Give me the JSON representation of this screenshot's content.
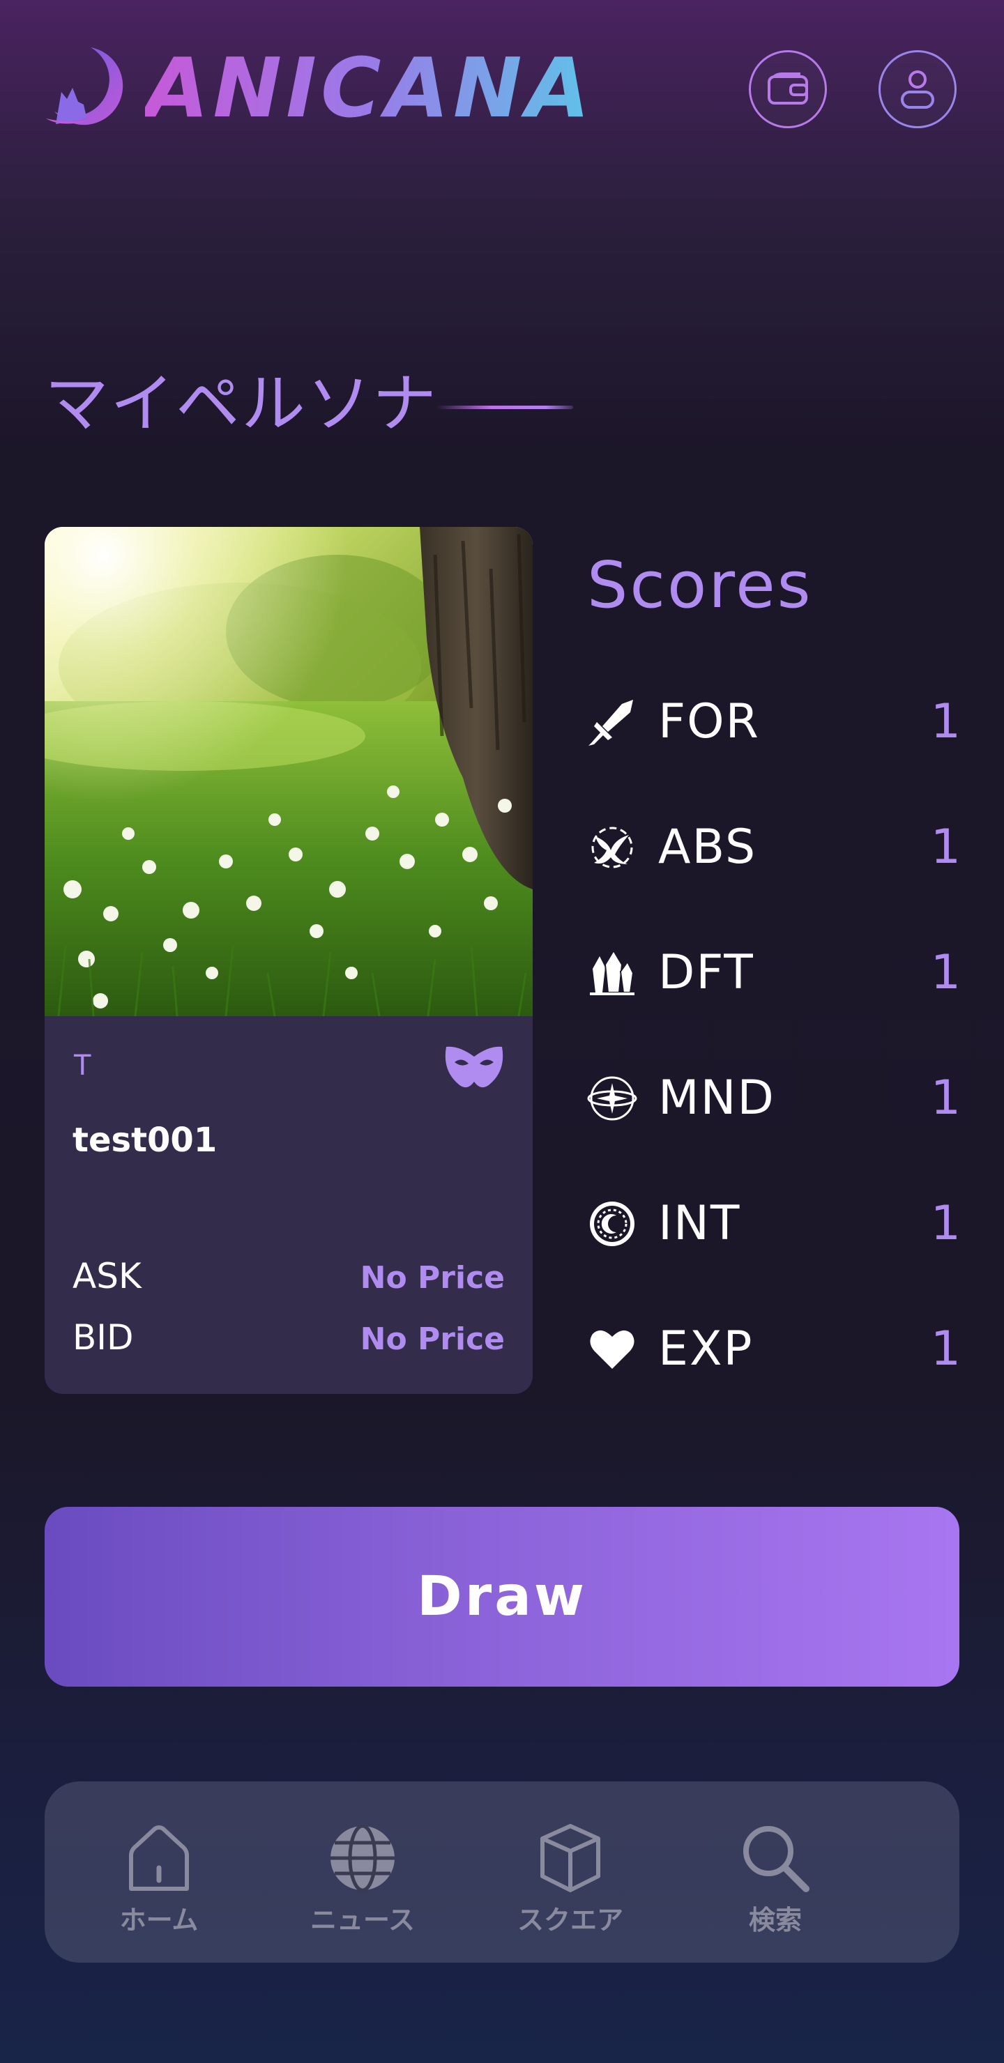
{
  "header": {
    "brand": "ANICANA",
    "wallet_icon": "wallet-icon",
    "user_icon": "user-icon"
  },
  "section": {
    "title": "マイペルソナ"
  },
  "persona_card": {
    "tag": "T",
    "mask_icon": "mask-icon",
    "name": "test001",
    "ask_label": "ASK",
    "ask_value": "No Price",
    "bid_label": "BID",
    "bid_value": "No Price"
  },
  "scores": {
    "title": "Scores",
    "items": [
      {
        "icon": "sword-icon",
        "label": "FOR",
        "value": "1"
      },
      {
        "icon": "bird-emblem-icon",
        "label": "ABS",
        "value": "1"
      },
      {
        "icon": "crystal-icon",
        "label": "DFT",
        "value": "1"
      },
      {
        "icon": "orbit-star-icon",
        "label": "MND",
        "value": "1"
      },
      {
        "icon": "moon-seal-icon",
        "label": "INT",
        "value": "1"
      },
      {
        "icon": "heart-icon",
        "label": "EXP",
        "value": "1"
      }
    ]
  },
  "draw_button": {
    "label": "Draw"
  },
  "bottom_nav": {
    "items": [
      {
        "icon": "home-icon",
        "label": "ホーム"
      },
      {
        "icon": "globe-icon",
        "label": "ニュース"
      },
      {
        "icon": "cube-icon",
        "label": "スクエア"
      },
      {
        "icon": "search-icon",
        "label": "検索"
      }
    ]
  },
  "colors": {
    "accent": "#b08cf0",
    "card_bg": "#332c4a",
    "draw_gradient_start": "#6a4cc0",
    "draw_gradient_end": "#a876f0"
  }
}
